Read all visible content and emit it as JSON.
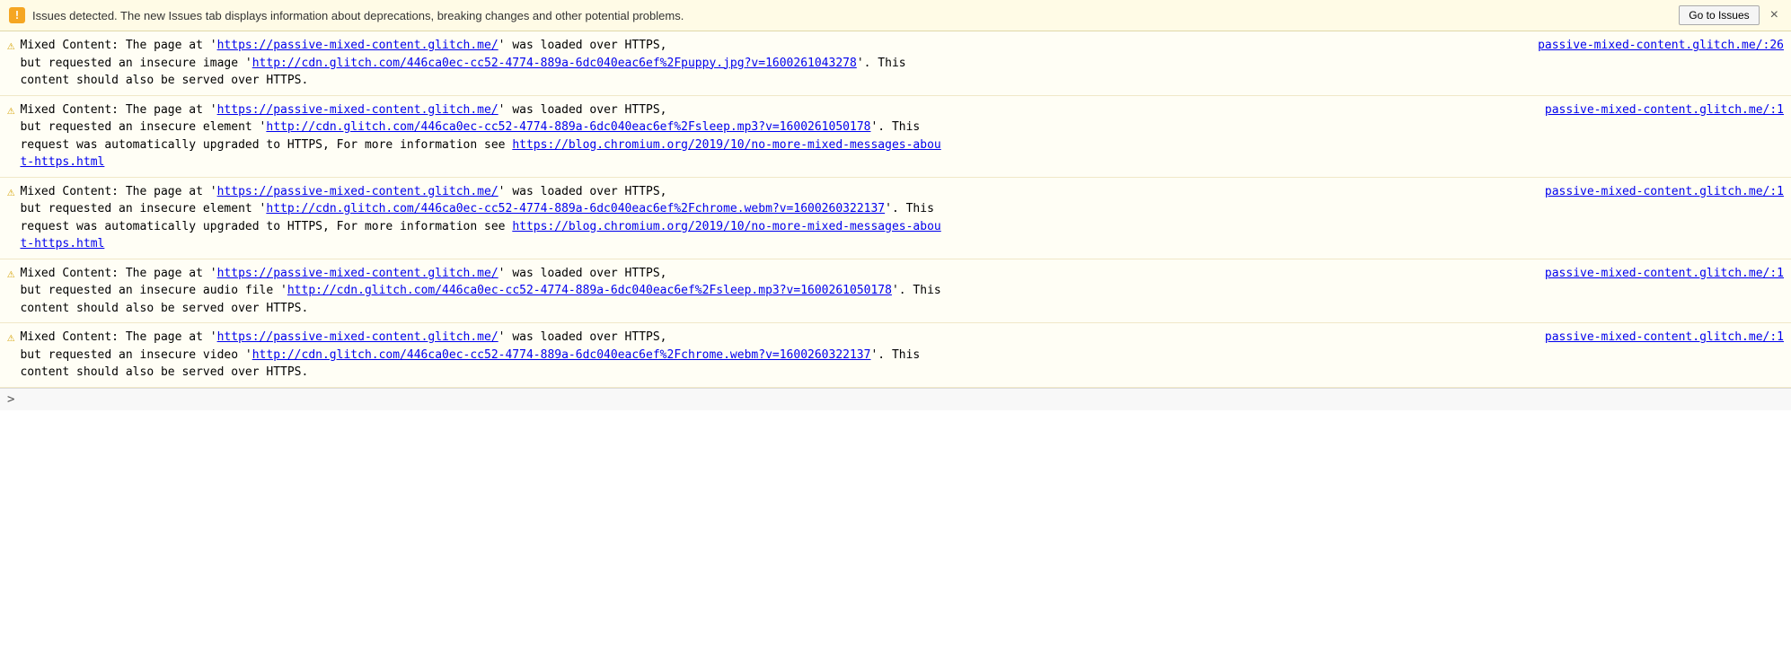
{
  "banner": {
    "icon": "!",
    "text": "Issues detected. The new Issues tab displays information about deprecations, breaking changes and other potential problems.",
    "go_to_issues_label": "Go to Issues",
    "close_label": "×"
  },
  "messages": [
    {
      "id": 1,
      "location": "passive-mixed-content.glitch.me/:26",
      "text_before": "Mixed Content: The page at '",
      "page_url": "https://passive-mixed-content.glitch.me/",
      "text_mid": "' was loaded over HTTPS,",
      "text_detail": "but requested an insecure image '",
      "resource_url": "http://cdn.glitch.com/446ca0ec-cc52-4774-889a-6dc040eac6ef%2Fpuppy.jpg?v=1600261043278",
      "text_end": "'. This content should also be served over HTTPS.",
      "extra_lines": []
    },
    {
      "id": 2,
      "location": "passive-mixed-content.glitch.me/:1",
      "text_before": "Mixed Content: The page at '",
      "page_url": "https://passive-mixed-content.glitch.me/",
      "text_mid": "' was loaded over HTTPS,",
      "text_detail": "but requested an insecure element '",
      "resource_url": "http://cdn.glitch.com/446ca0ec-cc52-4774-889a-6dc040eac6ef%2Fsleep.mp3?v=1600261050178",
      "text_end": "'. This request was automatically upgraded to HTTPS, For more information see",
      "blog_url": "https://blog.chromium.org/2019/10/no-more-mixed-messages-about-https.html",
      "blog_label": "https://blog.chromium.org/2019/10/no-more-mixed-messages-about-https.html",
      "extra_lines": []
    },
    {
      "id": 3,
      "location": "passive-mixed-content.glitch.me/:1",
      "text_before": "Mixed Content: The page at '",
      "page_url": "https://passive-mixed-content.glitch.me/",
      "text_mid": "' was loaded over HTTPS,",
      "text_detail": "but requested an insecure element '",
      "resource_url": "http://cdn.glitch.com/446ca0ec-cc52-4774-889a-6dc040eac6ef%2Fchrome.webm?v=1600260322137",
      "text_end": "'. This request was automatically upgraded to HTTPS, For more information see",
      "blog_url": "https://blog.chromium.org/2019/10/no-more-mixed-messages-about-https.html",
      "blog_label": "https://blog.chromium.org/2019/10/no-more-mixed-messages-about-https.html",
      "extra_lines": []
    },
    {
      "id": 4,
      "location": "passive-mixed-content.glitch.me/:1",
      "text_before": "Mixed Content: The page at '",
      "page_url": "https://passive-mixed-content.glitch.me/",
      "text_mid": "' was loaded over HTTPS,",
      "text_detail": "but requested an insecure audio file '",
      "resource_url": "http://cdn.glitch.com/446ca0ec-cc52-4774-889a-6dc040eac6ef%2Fsleep.mp3?v=1600261050178",
      "text_end": "'. This content should also be served over HTTPS.",
      "extra_lines": []
    },
    {
      "id": 5,
      "location": "passive-mixed-content.glitch.me/:1",
      "text_before": "Mixed Content: The page at '",
      "page_url": "https://passive-mixed-content.glitch.me/",
      "text_mid": "' was loaded over HTTPS,",
      "text_detail": "but requested an insecure video '",
      "resource_url": "http://cdn.glitch.com/446ca0ec-cc52-4774-889a-6dc040eac6ef%2Fchrome.webm?v=1600260322137",
      "text_end": "'. This content should also be served over HTTPS.",
      "extra_lines": []
    }
  ],
  "bottom": {
    "chevron": ">"
  }
}
